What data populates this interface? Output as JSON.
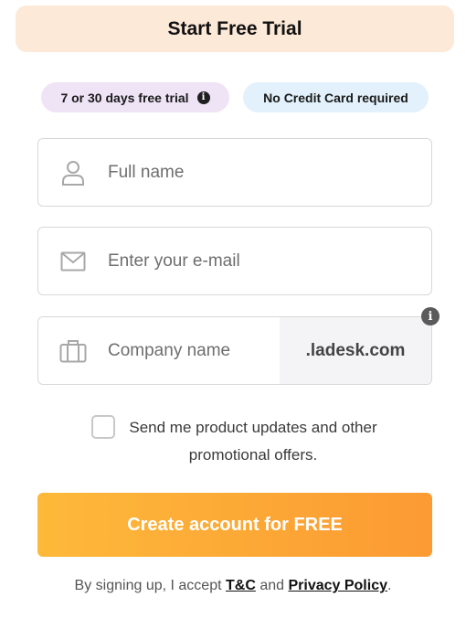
{
  "header": {
    "title": "Start Free Trial"
  },
  "badges": {
    "trial_label": "7 or 30 days free trial",
    "trial_info_glyph": "i",
    "no_card_label": "No Credit Card required"
  },
  "form": {
    "full_name": {
      "placeholder": "Full name",
      "value": "",
      "icon": "user-icon"
    },
    "email": {
      "placeholder": "Enter your e-mail",
      "value": "",
      "icon": "envelope-icon"
    },
    "company": {
      "placeholder": "Company name",
      "value": "",
      "icon": "briefcase-icon",
      "domain_suffix": ".ladesk.com",
      "info_glyph": "i"
    },
    "consent": {
      "label": "Send me product updates and other promotional offers.",
      "checked": false
    },
    "submit_label": "Create account for FREE"
  },
  "legal": {
    "prefix": "By signing up, I accept ",
    "tc_label": "T&C",
    "middle": " and ",
    "privacy_label": "Privacy Policy",
    "suffix": "."
  },
  "colors": {
    "header_bg": "#fde9d8",
    "trial_badge_bg": "#efe3f6",
    "card_badge_bg": "#e2f1fb",
    "cta_gradient_start": "#fdb93a",
    "cta_gradient_end": "#fc9a33"
  }
}
